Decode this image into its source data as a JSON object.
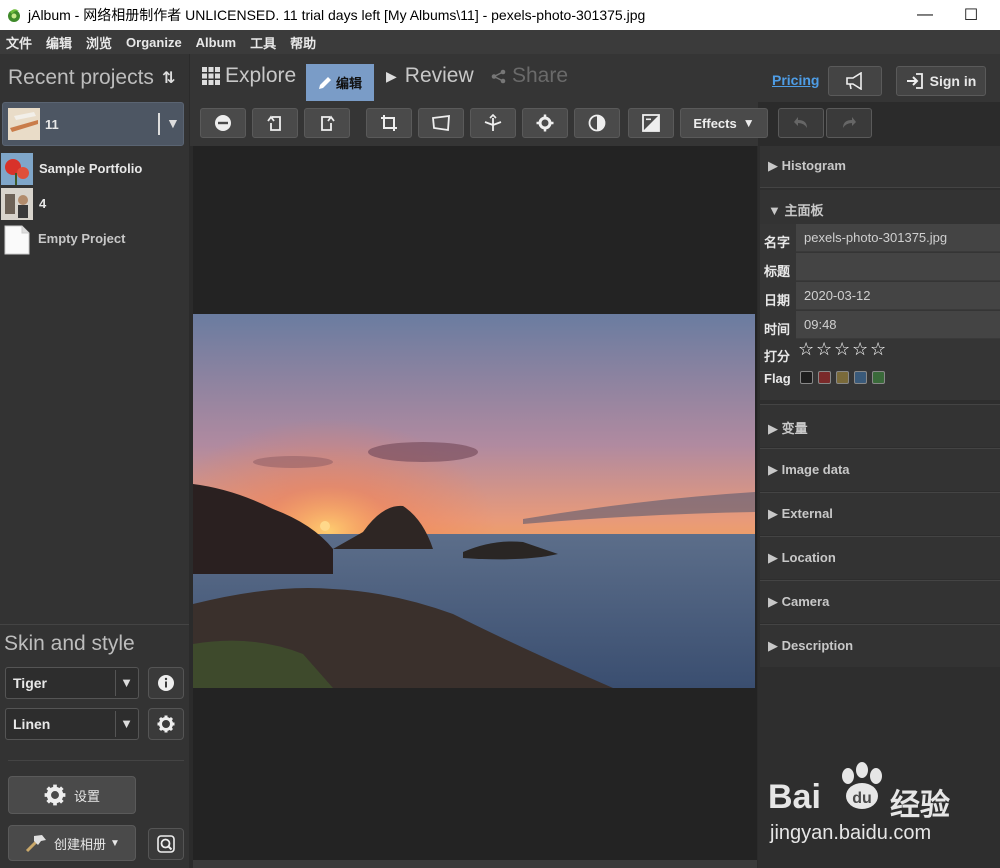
{
  "window": {
    "title": "jAlbum - 网络相册制作者 UNLICENSED. 11 trial days left [My Albums\\11] - pexels-photo-301375.jpg",
    "minimize_glyph": "—",
    "maximize_glyph": "☐"
  },
  "menu": [
    "文件",
    "编辑",
    "浏览",
    "Organize",
    "Album",
    "工具",
    "帮助"
  ],
  "left": {
    "recent_title": "Recent projects",
    "sort_glyph": "⇅",
    "projects": [
      {
        "name": "11",
        "selected": true
      },
      {
        "name": "Sample Portfolio"
      },
      {
        "name": "4"
      },
      {
        "name": "Empty Project"
      }
    ],
    "skin_title": "Skin and style",
    "skin_value": "Tiger",
    "style_value": "Linen",
    "settings_label": "设置",
    "make_album_label": "创建相册"
  },
  "tabs": {
    "explore": "Explore",
    "edit": "编辑",
    "review": "Review",
    "share": "Share",
    "pricing": "Pricing",
    "signin": "Sign in"
  },
  "toolbar": {
    "effects_label": "Effects"
  },
  "right": {
    "histogram": "Histogram",
    "main_panel": "主面板",
    "fields": [
      {
        "label": "名字",
        "value": "pexels-photo-301375.jpg"
      },
      {
        "label": "标题",
        "value": ""
      },
      {
        "label": "日期",
        "value": "2020-03-12"
      },
      {
        "label": "时间",
        "value": "09:48"
      }
    ],
    "rating_label": "打分",
    "rating_value": 0,
    "rating_max": 5,
    "flag_label": "Flag",
    "flag_colors": [
      "#1e1e1e",
      "#7a2a2a",
      "#7a6a3a",
      "#3a5a7a",
      "#3a6a3a"
    ],
    "sections": [
      "变量",
      "Image data",
      "External",
      "Location",
      "Camera",
      "Description"
    ]
  },
  "watermark": {
    "brand": "Bai",
    "brand2": "du",
    "cn": "经验",
    "url": "jingyan.baidu.com"
  },
  "colors": {
    "accent_tab": "#7a9cc7",
    "link": "#4e9de6"
  }
}
